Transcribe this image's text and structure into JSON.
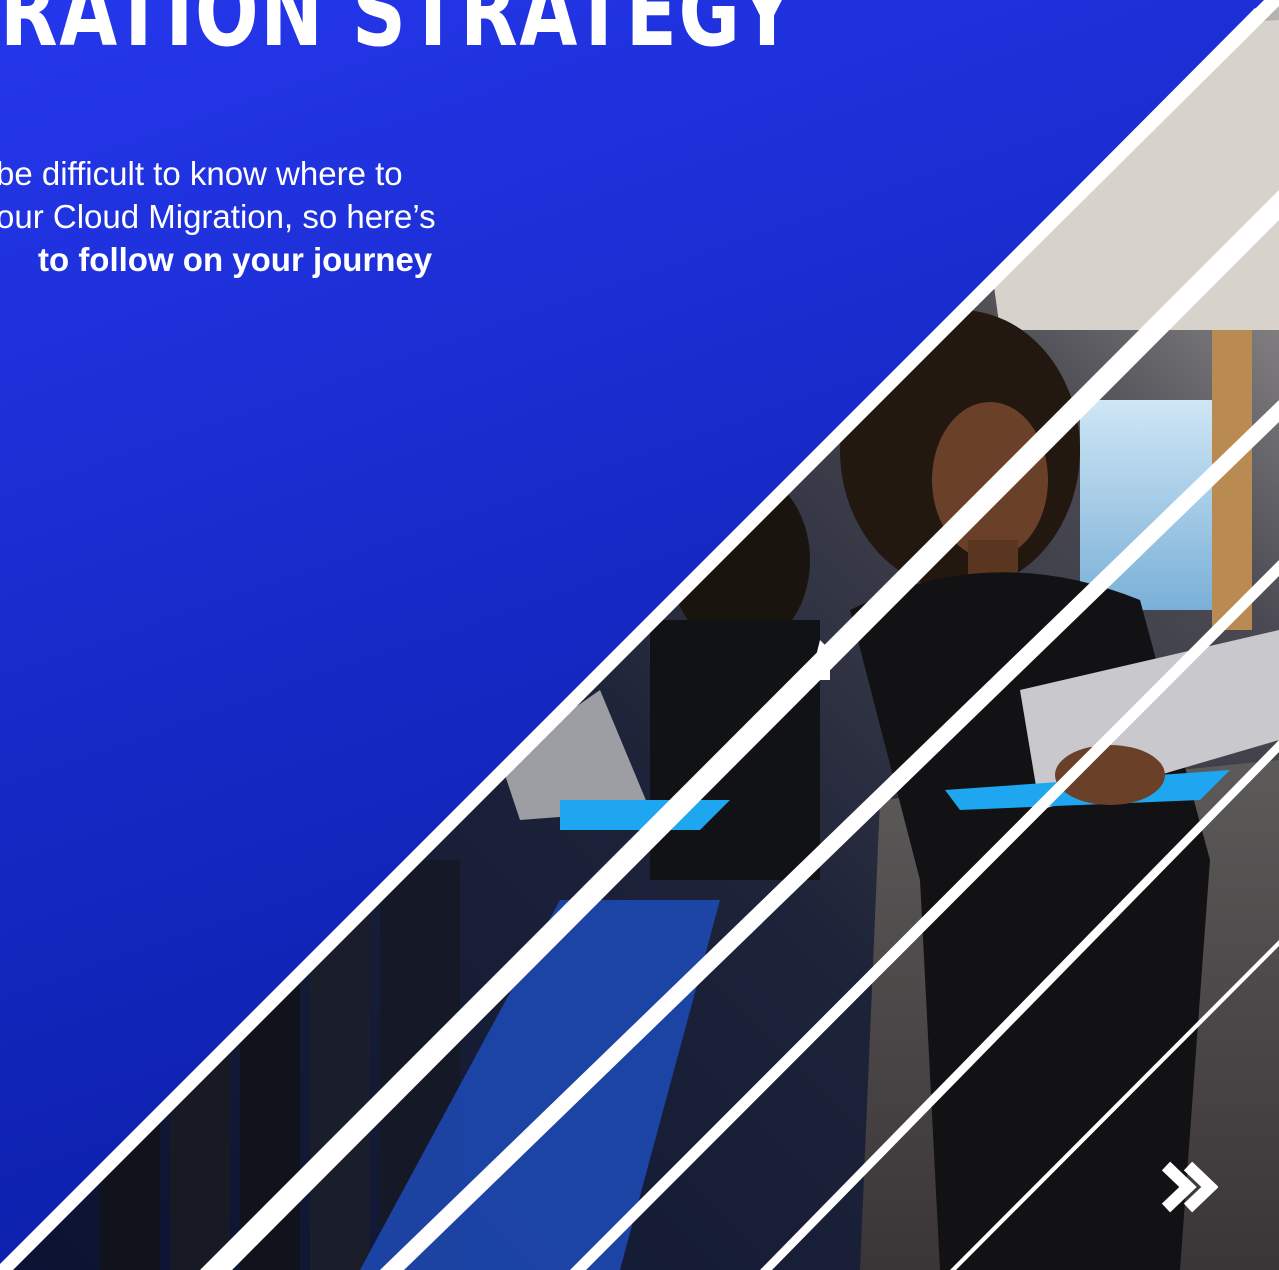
{
  "headline": "RATION STRATEGY",
  "intro": {
    "line1": "be difficult to know where to",
    "line2": "our Cloud Migration, so here’s",
    "line3": "to follow on your journey"
  },
  "colors": {
    "panel_top": "#2a3ef0",
    "panel_bottom": "#0a1faa",
    "accent_cyan": "#1ea6f0",
    "stripe": "#ffffff"
  },
  "icons": {
    "next": "double-chevron-right-icon"
  },
  "image": {
    "subject": "person-with-laptop-photo"
  }
}
